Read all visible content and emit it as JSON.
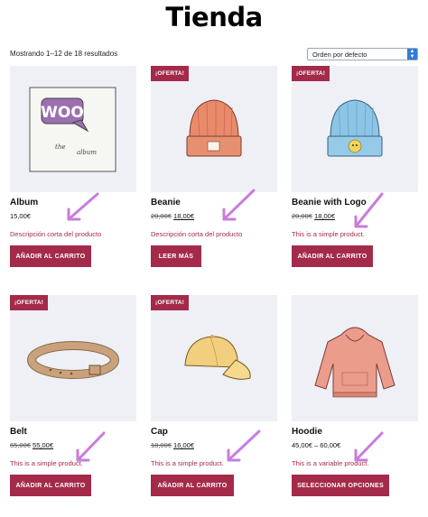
{
  "page": {
    "title": "Tienda"
  },
  "toolbar": {
    "result_count": "Mostrando 1–12 de 18 resultados",
    "ordering_value": "Orden por defecto"
  },
  "colors": {
    "accent": "#a42a4a",
    "thumb_bg": "#eef0f6",
    "annotation_arrow": "#c77ddd"
  },
  "products": [
    {
      "name": "Album",
      "price": "15,00€",
      "price_old": "",
      "price_new": "",
      "badge": "",
      "description": "Descripción corta del producto",
      "button": "AÑADIR AL CARRITO",
      "image": "album-icon"
    },
    {
      "name": "Beanie",
      "price": "",
      "price_old": "20,00€",
      "price_new": "18,00€",
      "badge": "¡OFERTA!",
      "description": "Descripción corta del producto",
      "button": "LEER MÁS",
      "image": "beanie-icon"
    },
    {
      "name": "Beanie with Logo",
      "price": "",
      "price_old": "20,00€",
      "price_new": "18,00€",
      "badge": "¡OFERTA!",
      "description": "This is a simple product.",
      "button": "AÑADIR AL CARRITO",
      "image": "beanie-logo-icon"
    },
    {
      "name": "Belt",
      "price": "",
      "price_old": "65,00€",
      "price_new": "55,00€",
      "badge": "¡OFERTA!",
      "description": "This is a simple product.",
      "button": "AÑADIR AL CARRITO",
      "image": "belt-icon"
    },
    {
      "name": "Cap",
      "price": "",
      "price_old": "18,00€",
      "price_new": "16,00€",
      "badge": "¡OFERTA!",
      "description": "This is a simple product.",
      "button": "AÑADIR AL CARRITO",
      "image": "cap-icon"
    },
    {
      "name": "Hoodie",
      "price": "45,00€ – 60,00€",
      "price_old": "",
      "price_new": "",
      "badge": "",
      "description": "This is a variable product.",
      "button": "SELECCIONAR OPCIONES",
      "image": "hoodie-icon"
    }
  ]
}
